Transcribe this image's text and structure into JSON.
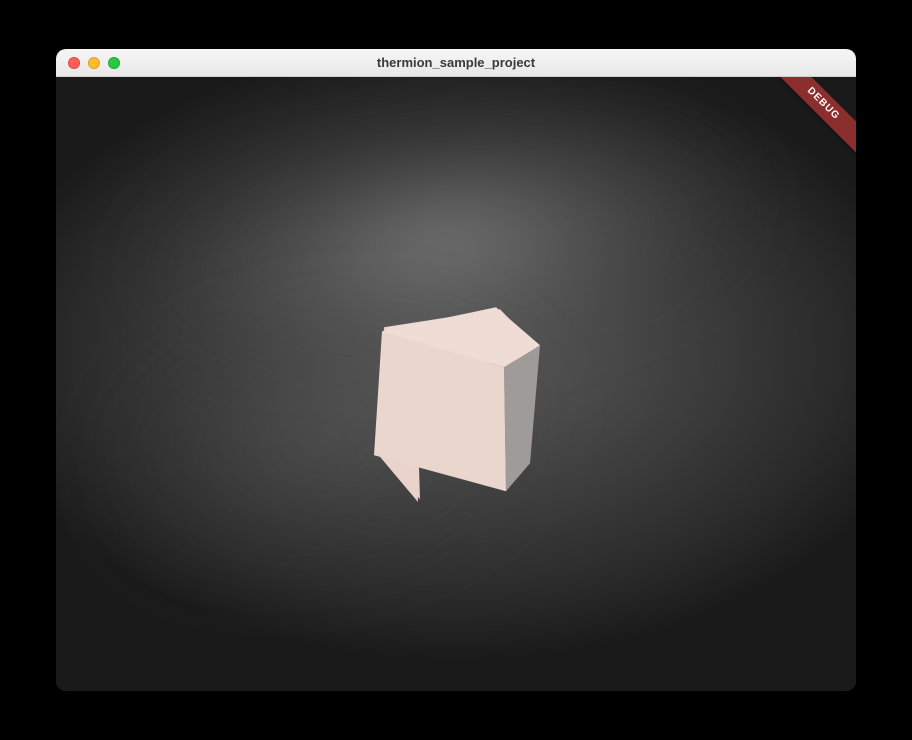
{
  "window": {
    "title": "thermion_sample_project"
  },
  "debug": {
    "ribbon_label": "DEBUG"
  },
  "scene": {
    "object": "cube",
    "colors": {
      "cube_top": "#e8d6cf",
      "cube_front": "#e9d4cb",
      "cube_right": "#a8a5a3",
      "background_vignette": "#1a1a1a",
      "background_mid": "#4a4a4a"
    }
  },
  "traffic_lights": {
    "close": "close-icon",
    "minimize": "minimize-icon",
    "maximize": "maximize-icon"
  }
}
